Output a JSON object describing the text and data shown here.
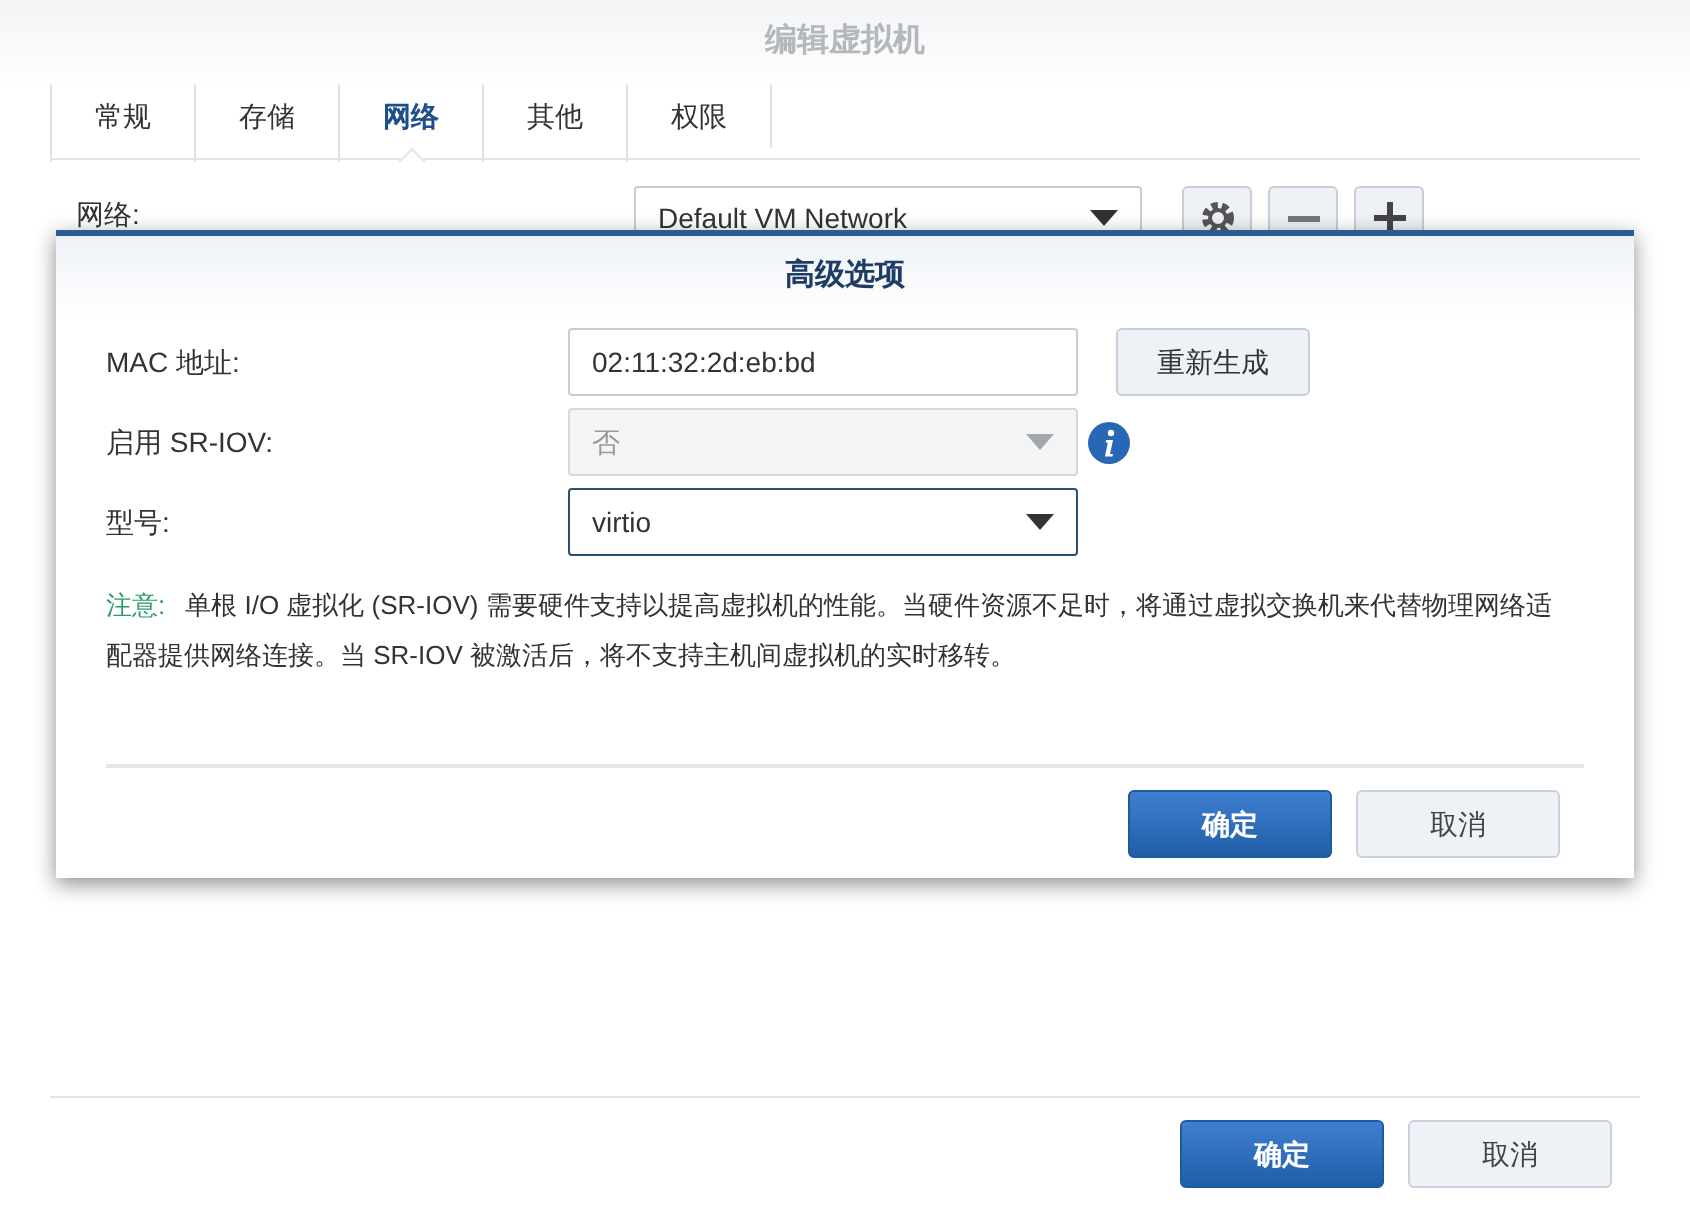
{
  "window": {
    "title": "编辑虚拟机"
  },
  "tabs": [
    {
      "label": "常规",
      "selected": false
    },
    {
      "label": "存储",
      "selected": false
    },
    {
      "label": "网络",
      "selected": true
    },
    {
      "label": "其他",
      "selected": false
    },
    {
      "label": "权限",
      "selected": false
    }
  ],
  "network": {
    "label": "网络:",
    "value": "Default VM Network"
  },
  "dialog": {
    "title": "高级选项",
    "mac": {
      "label": "MAC 地址:",
      "value": "02:11:32:2d:eb:bd",
      "button": "重新生成"
    },
    "sriov": {
      "label": "启用 SR-IOV:",
      "value": "否",
      "disabled": true
    },
    "model": {
      "label": "型号:",
      "value": "virtio"
    },
    "note": {
      "label": "注意:",
      "text": "单根 I/O 虚拟化 (SR-IOV) 需要硬件支持以提高虚拟机的性能。当硬件资源不足时，将通过虚拟交换机来代替物理网络适配器提供网络连接。当 SR-IOV 被激活后，将不支持主机间虚拟机的实时移转。"
    },
    "buttons": {
      "ok": "确定",
      "cancel": "取消"
    }
  },
  "buttons": {
    "ok": "确定",
    "cancel": "取消"
  }
}
